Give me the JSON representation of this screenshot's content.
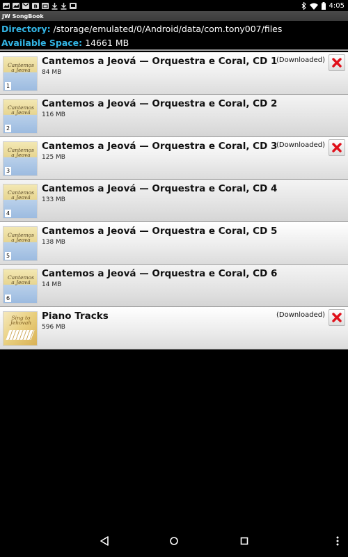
{
  "status_bar": {
    "time": "4:05",
    "notification_icons": [
      "image-icon",
      "image-icon",
      "gmail-icon",
      "blogger-icon",
      "calendar-icon",
      "download-icon",
      "download-icon",
      "photos-icon"
    ]
  },
  "app": {
    "title": "JW SongBook"
  },
  "info": {
    "directory_label": "Directory:",
    "directory_value": "/storage/emulated/0/Android/data/com.tony007/files",
    "space_label": "Available Space:",
    "space_value": "14661 MB"
  },
  "items": [
    {
      "title": "Cantemos a Jeová — Orquestra e Coral, CD 1",
      "size": "84 MB",
      "status": "(Downloaded)",
      "cover_text": "Cantemos a Jeová",
      "cd_number": "1",
      "downloaded": true
    },
    {
      "title": "Cantemos a Jeová — Orquestra e Coral, CD 2",
      "size": "116 MB",
      "status": "",
      "cover_text": "Cantemos a Jeová",
      "cd_number": "2",
      "downloaded": false
    },
    {
      "title": "Cantemos a Jeová — Orquestra e Coral, CD 3",
      "size": "125 MB",
      "status": "(Downloaded)",
      "cover_text": "Cantemos a Jeová",
      "cd_number": "3",
      "downloaded": true
    },
    {
      "title": "Cantemos a Jeová — Orquestra e Coral, CD 4",
      "size": "133 MB",
      "status": "",
      "cover_text": "Cantemos a Jeová",
      "cd_number": "4",
      "downloaded": false
    },
    {
      "title": "Cantemos a Jeová — Orquestra e Coral, CD 5",
      "size": "138 MB",
      "status": "",
      "cover_text": "Cantemos a Jeová",
      "cd_number": "5",
      "downloaded": false
    },
    {
      "title": "Cantemos a Jeová — Orquestra e Coral, CD 6",
      "size": "14 MB",
      "status": "",
      "cover_text": "Cantemos a Jeová",
      "cd_number": "6",
      "downloaded": false
    },
    {
      "title": "Piano Tracks",
      "size": "596 MB",
      "status": "(Downloaded)",
      "cover_text": "Sing to Jehovah",
      "cd_number": "",
      "downloaded": true
    }
  ],
  "colors": {
    "accent": "#33b5e5",
    "delete": "#e0101a"
  }
}
